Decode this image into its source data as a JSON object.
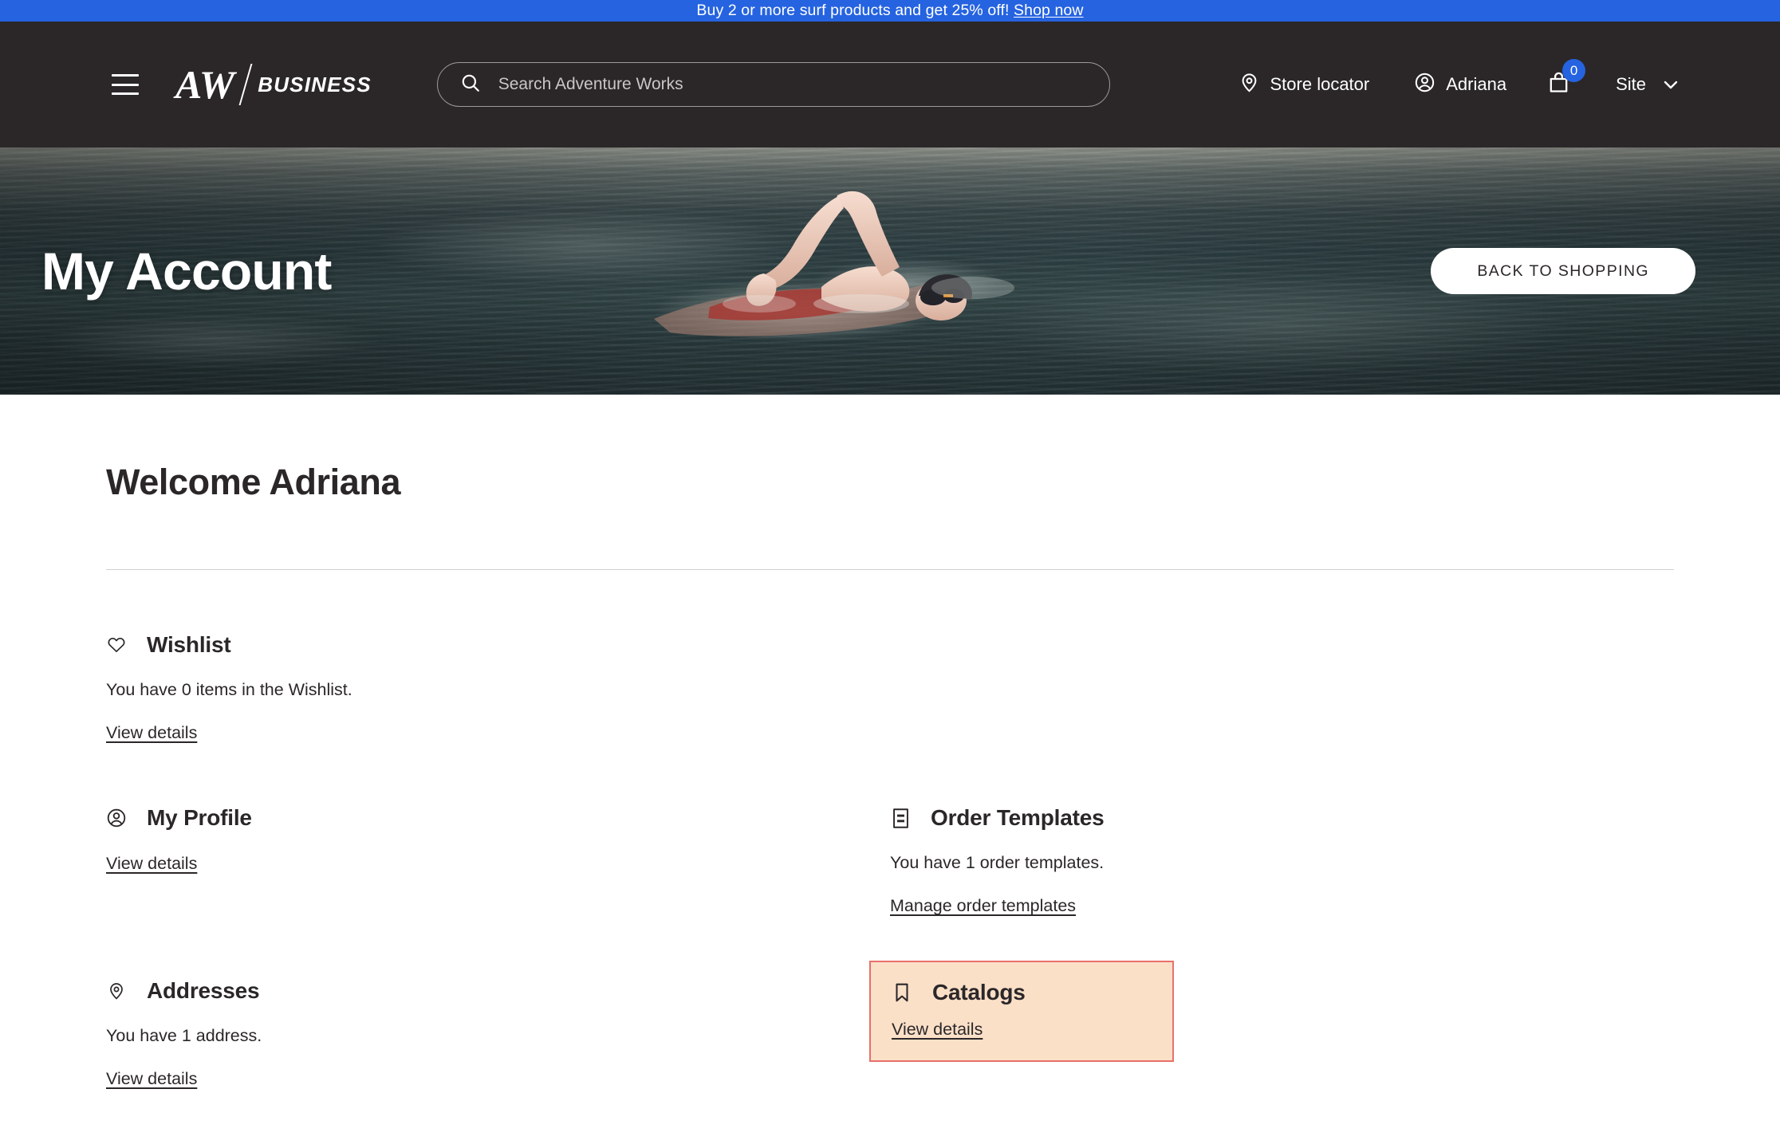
{
  "promo": {
    "text": "Buy 2 or more surf products and get 25% off! ",
    "link_label": "Shop now",
    "background": "#2563e0"
  },
  "header": {
    "menu_icon": "hamburger-menu-icon",
    "brand": {
      "mark": "AW",
      "suffix": "BUSINESS"
    },
    "search": {
      "placeholder": "Search Adventure Works",
      "value": "",
      "icon": "search-icon"
    },
    "store_locator": {
      "label": "Store locator",
      "icon": "location-pin-icon"
    },
    "account": {
      "label": "Adriana",
      "icon": "user-circle-icon"
    },
    "cart": {
      "count": "0",
      "icon": "shopping-bag-icon",
      "badge_color": "#2563e0"
    },
    "site_selector": {
      "label": "Site",
      "icon": "chevron-down-icon"
    },
    "background": "#2b2729"
  },
  "hero": {
    "title": "My Account",
    "button_label": "BACK TO SHOPPING",
    "image_alt": "swimmer-freestyle-open-water"
  },
  "main": {
    "welcome": "Welcome Adriana",
    "cards": [
      {
        "id": "wishlist",
        "icon": "heart-icon",
        "title": "Wishlist",
        "description": "You have 0 items in the Wishlist.",
        "link_label": "View details",
        "highlighted": false
      },
      {
        "id": "my-profile",
        "icon": "user-circle-icon",
        "title": "My Profile",
        "description": "",
        "link_label": "View details",
        "highlighted": false
      },
      {
        "id": "order-templates",
        "icon": "document-list-icon",
        "title": "Order Templates",
        "description": "You have 1 order templates.",
        "link_label": "Manage order templates",
        "highlighted": false
      },
      {
        "id": "addresses",
        "icon": "location-pin-icon",
        "title": "Addresses",
        "description": "You have 1 address.",
        "link_label": "View details",
        "highlighted": false
      },
      {
        "id": "catalogs",
        "icon": "bookmark-icon",
        "title": "Catalogs",
        "description": "",
        "link_label": "View details",
        "highlighted": true,
        "highlight_background": "#fbe0c8",
        "highlight_border": "#e8706a"
      }
    ]
  }
}
